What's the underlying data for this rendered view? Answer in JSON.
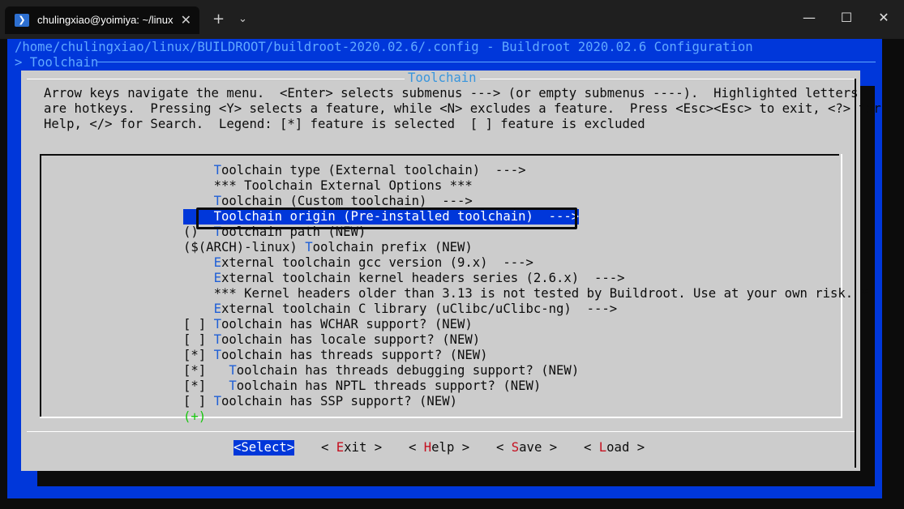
{
  "window": {
    "tab_title": "chulingxiao@yoimiya: ~/linux",
    "new_tab_icon": "plus-icon",
    "dropdown_icon": "chevron-down-icon",
    "minimize_icon": "minimize-icon",
    "maximize_icon": "maximize-icon",
    "close_icon": "close-icon"
  },
  "header": {
    "path": "/home/chulingxiao/linux/BUILDROOT/buildroot-2020.02.6/.config - Buildroot 2020.02.6 Configuration",
    "breadcrumb": "> Toolchain"
  },
  "dialog": {
    "title": "Toolchain",
    "help_lines": [
      "Arrow keys navigate the menu.  <Enter> selects submenus ---> (or empty submenus ----).  Highlighted letters",
      "are hotkeys.  Pressing <Y> selects a feature, while <N> excludes a feature.  Press <Esc><Esc> to exit, <?> for",
      "Help, </> for Search.  Legend: [*] feature is selected  [ ] feature is excluded"
    ]
  },
  "menu": {
    "selected_index": 3,
    "items": [
      {
        "prefix": "    ",
        "hotkey": "T",
        "rest": "oolchain type (External toolchain)  --->"
      },
      {
        "prefix": "    ",
        "hotkey": "",
        "rest": "*** Toolchain External Options ***"
      },
      {
        "prefix": "    ",
        "hotkey": "T",
        "rest": "oolchain (Custom toolchain)  --->"
      },
      {
        "prefix": "    ",
        "hotkey": "T",
        "rest": "oolchain origin (Pre-installed toolchain)  --->"
      },
      {
        "prefix": "()  ",
        "hotkey": "T",
        "rest": "oolchain path (NEW)"
      },
      {
        "prefix": "($(ARCH)-linux) ",
        "hotkey": "T",
        "rest": "oolchain prefix (NEW)"
      },
      {
        "prefix": "    ",
        "hotkey": "E",
        "rest": "xternal toolchain gcc version (9.x)  --->"
      },
      {
        "prefix": "    ",
        "hotkey": "E",
        "rest": "xternal toolchain kernel headers series (2.6.x)  --->"
      },
      {
        "prefix": "    ",
        "hotkey": "",
        "rest": "*** Kernel headers older than 3.13 is not tested by Buildroot. Use at your own risk. *"
      },
      {
        "prefix": "    ",
        "hotkey": "E",
        "rest": "xternal toolchain C library (uClibc/uClibc-ng)  --->"
      },
      {
        "prefix": "[ ] ",
        "hotkey": "T",
        "rest": "oolchain has WCHAR support? (NEW)"
      },
      {
        "prefix": "[ ] ",
        "hotkey": "T",
        "rest": "oolchain has locale support? (NEW)"
      },
      {
        "prefix": "[*] ",
        "hotkey": "T",
        "rest": "oolchain has threads support? (NEW)"
      },
      {
        "prefix": "[*]   ",
        "hotkey": "T",
        "rest": "oolchain has threads debugging support? (NEW)"
      },
      {
        "prefix": "[*]   ",
        "hotkey": "T",
        "rest": "oolchain has NPTL threads support? (NEW)"
      },
      {
        "prefix": "[ ] ",
        "hotkey": "T",
        "rest": "oolchain has SSP support? (NEW)"
      }
    ],
    "more_indicator": "(+)"
  },
  "buttons": [
    {
      "pre": "<",
      "hotkey": "Select",
      "post": ">",
      "selected": true
    },
    {
      "pre": "< ",
      "hotkey": "E",
      "rest": "xit",
      "post": " >",
      "selected": false
    },
    {
      "pre": "< ",
      "hotkey": "H",
      "rest": "elp",
      "post": " >",
      "selected": false
    },
    {
      "pre": "< ",
      "hotkey": "S",
      "rest": "ave",
      "post": " >",
      "selected": false
    },
    {
      "pre": "< ",
      "hotkey": "L",
      "rest": "oad",
      "post": " >",
      "selected": false
    }
  ],
  "colors": {
    "terminal_blue": "#0037da",
    "dialog_gray": "#cccccc",
    "hotkey_blue": "#1f5fd6",
    "hotkey_red": "#c50f1f",
    "more_green": "#16c60c"
  }
}
